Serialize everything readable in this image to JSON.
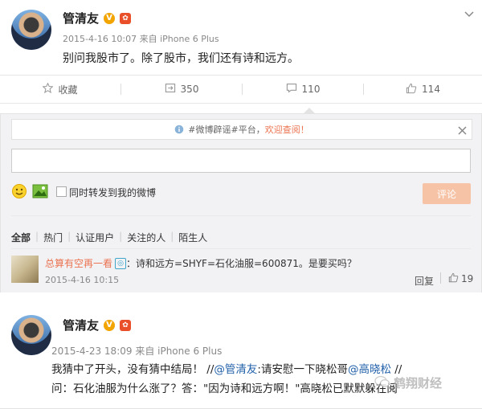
{
  "post1": {
    "author": "管清友",
    "meta": "2015-4-16 10:07 来自 iPhone 6 Plus",
    "content": "别问我股市了。除了股市，我们还有诗和远方。"
  },
  "actions": {
    "favorite": "收藏",
    "repost": "350",
    "comment": "110",
    "like": "114"
  },
  "notice": {
    "prefix": "#微博辟谣#平台，",
    "highlight": "欢迎查阅！"
  },
  "composer": {
    "checkbox_label": "同时转发到我的微博",
    "submit": "评论"
  },
  "filters": [
    "全部",
    "热门",
    "认证用户",
    "关注的人",
    "陌生人"
  ],
  "comment": {
    "user": "总算有空再一看",
    "text": "：诗和远方=SHYF=石化油服=600871。是要买吗？",
    "time": "2015-4-16 10:15",
    "reply": "回复",
    "likes": "19"
  },
  "post2": {
    "author": "管清友",
    "meta": "2015-4-23 18:09 来自 iPhone 6 Plus",
    "line1_a": "我猜中了开头，没有猜中结局！ //",
    "mention1": "@管清友",
    "line1_b": ":请安慰一下晓松哥",
    "mention2": "@高晓松",
    "line1_c": " //",
    "line2": "问：石化油服为什么涨了？答：\"因为诗和远方啊！\"高晓松已默默躲在阅"
  },
  "watermark": "鹤翔财经",
  "colors": {
    "accent": "#eb7350",
    "link": "#1f5fa8",
    "vip": "#f2a400"
  }
}
